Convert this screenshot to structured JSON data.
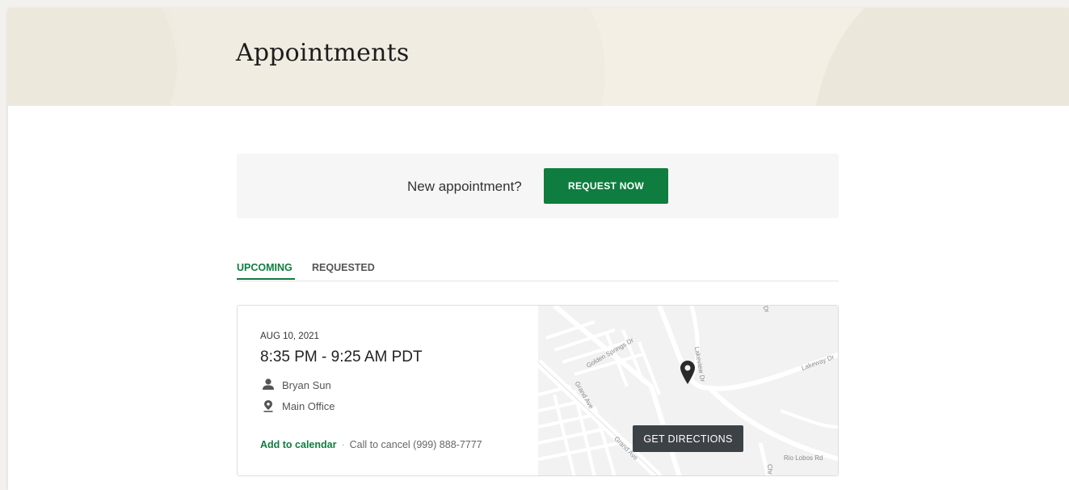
{
  "header": {
    "title": "Appointments"
  },
  "request": {
    "prompt": "New appointment?",
    "button_label": "REQUEST NOW"
  },
  "tabs": [
    {
      "label": "UPCOMING",
      "active": true
    },
    {
      "label": "REQUESTED",
      "active": false
    }
  ],
  "appointment": {
    "date": "AUG 10, 2021",
    "time": "8:35 PM - 9:25 AM PDT",
    "provider": "Bryan Sun",
    "location": "Main Office",
    "add_to_calendar_label": "Add to calendar",
    "separator": "·",
    "cancel_text": "Call to cancel (999) 888-7777"
  },
  "map": {
    "directions_label": "GET DIRECTIONS",
    "streets": {
      "golden_springs": "Golden Springs Dr",
      "grand_ave_1": "Grand Ave",
      "grand_ave_2": "Grand Ave",
      "lakeview": "Lakeview Dr",
      "lakeway": "Lakeway Dr",
      "rio_lobos": "Rio Lobos Rd",
      "ch": "Chr",
      "dr": "Dr"
    },
    "icons": {
      "pin": "map-pin-icon"
    }
  },
  "colors": {
    "accent": "#0e7d3f",
    "banner": "#efebe0",
    "dark_button": "#3d4246"
  }
}
